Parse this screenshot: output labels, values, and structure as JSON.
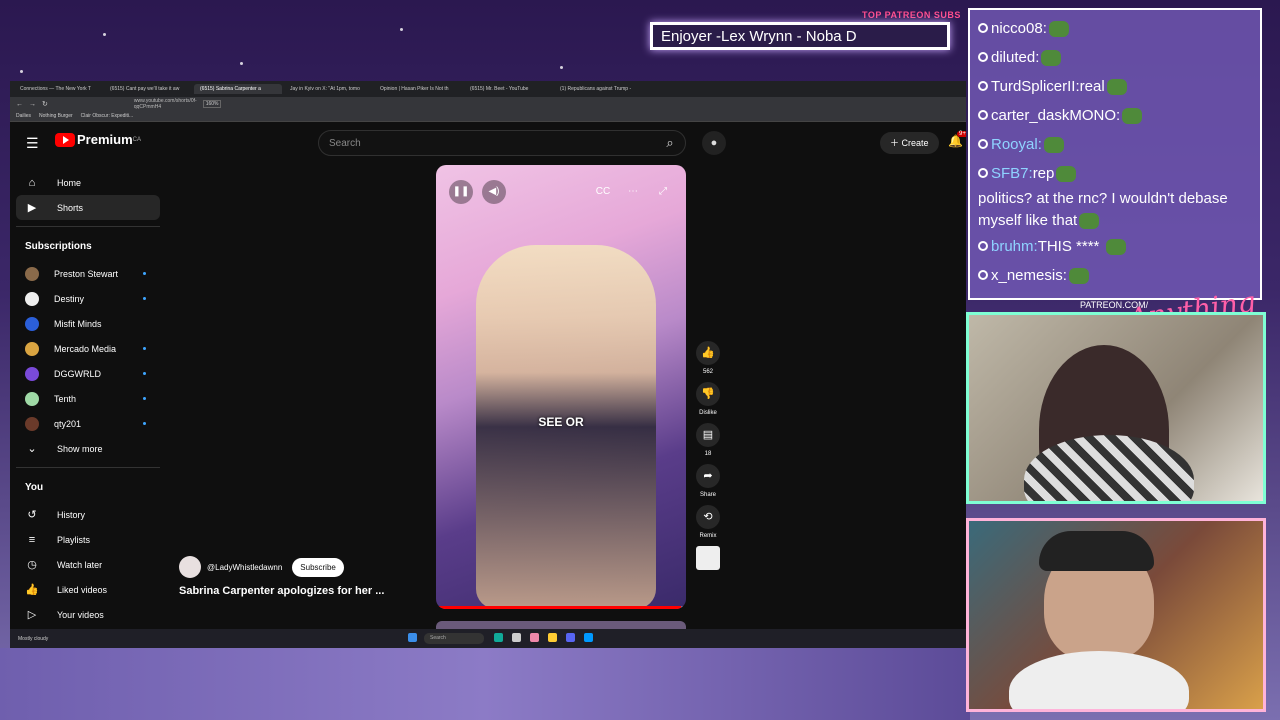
{
  "overlay": {
    "patreon_label": "TOP PATREON SUBS",
    "subs_text": "Enjoyer -Lex Wrynn -  Noba D",
    "patreon_url": "PATREON.COM/",
    "anything_logo": "Anything Else"
  },
  "chat": [
    {
      "name": "nicco08:",
      "text": "",
      "blue": false
    },
    {
      "name": "diluted:",
      "text": "",
      "blue": false
    },
    {
      "name": "TurdSplicerII:",
      "text": "real",
      "blue": false
    },
    {
      "name": "carter_daskMONO:",
      "text": "",
      "blue": false
    },
    {
      "name": "Rooyal:",
      "text": "",
      "blue": true
    },
    {
      "name": "SFB7:",
      "text": "rep",
      "blue": true
    },
    {
      "name": "",
      "text": "politics? at the rnc? I wouldn't debase myself like that",
      "blue": false
    },
    {
      "name": "bruhm:",
      "text": "THIS **** ",
      "blue": true
    },
    {
      "name": "x_nemesis:",
      "text": "",
      "blue": false
    }
  ],
  "browser": {
    "tabs": [
      "Connections — The New York T",
      "(6515) Cant pay we'll take it aw",
      "(6515) Sabrina Carpenter a",
      "Jay in Kyiv on X: \"At 1pm, tomo",
      "Opinion | Hasan Piker Is Not th",
      "(6515) Mr. Beet - YouTube",
      "(1) Republicans against Trump -"
    ],
    "url": "www.youtube.com/shorts/0f-qqCPmmH4",
    "bookmarks": [
      "Dailies",
      "Nothing Burger",
      "Clair Obscur: Expediti..."
    ],
    "zoom": "160%"
  },
  "youtube": {
    "logo_text": "Premium",
    "logo_country": "CA",
    "search_placeholder": "Search",
    "create_label": "Create",
    "notification_count": "9+",
    "sidebar_main": [
      {
        "label": "Home",
        "icon": "home-icon"
      },
      {
        "label": "Shorts",
        "icon": "shorts-icon",
        "active": true
      }
    ],
    "subscriptions_heading": "Subscriptions",
    "subscriptions": [
      {
        "label": "Preston Stewart",
        "color": "#8a6a4a",
        "dot": true
      },
      {
        "label": "Destiny",
        "color": "#eeeeee",
        "dot": true
      },
      {
        "label": "Misfit Minds",
        "color": "#2b5fd9",
        "dot": false
      },
      {
        "label": "Mercado Media",
        "color": "#d9a441",
        "dot": true
      },
      {
        "label": "DGGWRLD",
        "color": "#7a4ad9",
        "dot": true
      },
      {
        "label": "Tenth",
        "color": "#9fd9a6",
        "dot": true
      },
      {
        "label": "qty201",
        "color": "#6a3a2a",
        "dot": true
      }
    ],
    "show_more": "Show more",
    "you_heading": "You",
    "you_items": [
      {
        "label": "History",
        "icon": "history-icon"
      },
      {
        "label": "Playlists",
        "icon": "playlists-icon"
      },
      {
        "label": "Watch later",
        "icon": "watch-later-icon"
      },
      {
        "label": "Liked videos",
        "icon": "liked-icon"
      },
      {
        "label": "Your videos",
        "icon": "your-videos-icon"
      }
    ],
    "short": {
      "caption": "SEE OR",
      "channel": "@LadyWhistledawnn",
      "subscribe": "Subscribe",
      "title": "Sabrina Carpenter apologizes for her ...",
      "likes": "562",
      "dislike_label": "Dislike",
      "comments": "18",
      "share_label": "Share",
      "remix_label": "Remix",
      "progress": 0.98
    }
  },
  "taskbar": {
    "weather": "Mostly cloudy",
    "search": "Search"
  }
}
